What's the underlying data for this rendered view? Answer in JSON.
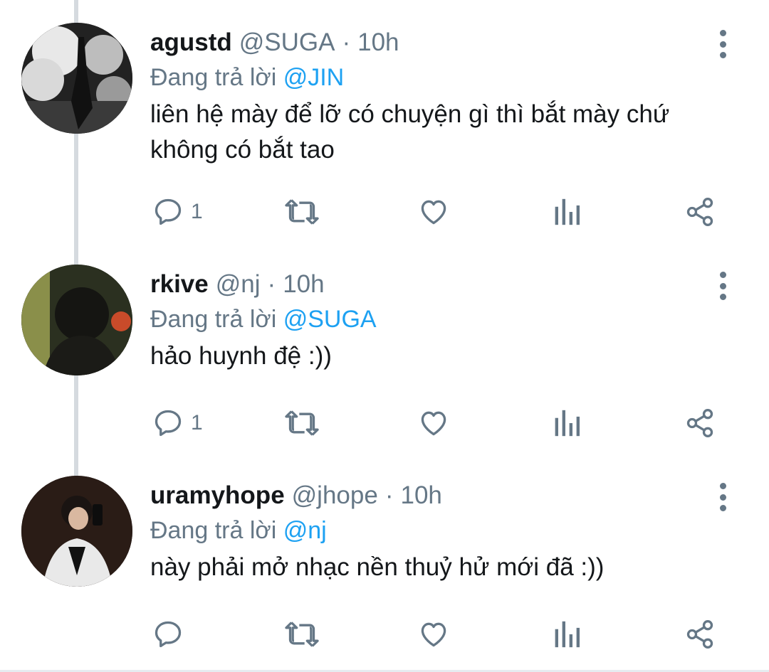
{
  "tweets": [
    {
      "display_name": "agustd",
      "handle": "@SUGA",
      "separator": "·",
      "time": "10h",
      "reply_prefix": "Đang trả lời",
      "reply_to": "@JIN",
      "text": "liên hệ mày để lỡ có chuyện gì thì bắt mày chứ không có bắt tao",
      "reply_count": "1",
      "icons": [
        "reply-icon",
        "retweet-icon",
        "like-icon",
        "analytics-icon",
        "share-icon",
        "more-icon"
      ]
    },
    {
      "display_name": "rkive",
      "handle": "@nj",
      "separator": "·",
      "time": "10h",
      "reply_prefix": "Đang trả lời",
      "reply_to": "@SUGA",
      "text": "hảo huynh đệ :))",
      "reply_count": "1",
      "icons": [
        "reply-icon",
        "retweet-icon",
        "like-icon",
        "analytics-icon",
        "share-icon",
        "more-icon"
      ]
    },
    {
      "display_name": "uramyhope",
      "handle": "@jhope",
      "separator": "·",
      "time": "10h",
      "reply_prefix": "Đang trả lời",
      "reply_to": "@nj",
      "text": "này phải mở nhạc nền thuỷ hử mới đã :))",
      "reply_count": "",
      "icons": [
        "reply-icon",
        "retweet-icon",
        "like-icon",
        "analytics-icon",
        "share-icon",
        "more-icon"
      ]
    }
  ],
  "colors": {
    "text_primary": "#14171a",
    "text_secondary": "#657786",
    "mention": "#1da1f2",
    "thread_line": "#d5dadf"
  }
}
